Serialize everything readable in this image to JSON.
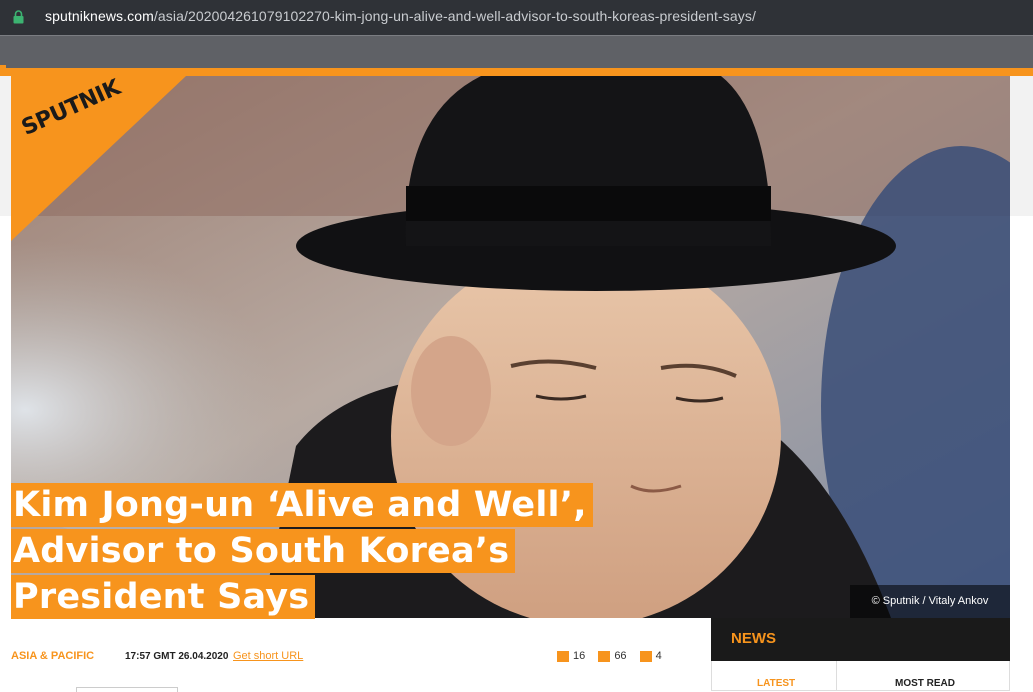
{
  "browser": {
    "url_domain": "sputniknews.com",
    "url_path": "/asia/202004261079102270-kim-jong-un-alive-and-well-advisor-to-south-koreas-president-says/",
    "lock_icon": "lock-icon"
  },
  "site": {
    "logo_text": "SPUTNIK",
    "accent_color": "#f7941d"
  },
  "article": {
    "headline_lines": [
      "Kim Jong-un ‘Alive and Well’,",
      "Advisor to South Korea’s",
      "President Says"
    ],
    "photo_credit": "© Sputnik / Vitaly Ankov",
    "category": "ASIA & PACIFIC",
    "datetime": "17:57 GMT 26.04.2020",
    "short_url_label": "Get short URL",
    "stats": {
      "comments": "16",
      "likes": "66",
      "dislikes": "4"
    }
  },
  "news_panel": {
    "title": "NEWS",
    "tabs": [
      "LATEST",
      "MOST READ"
    ]
  }
}
